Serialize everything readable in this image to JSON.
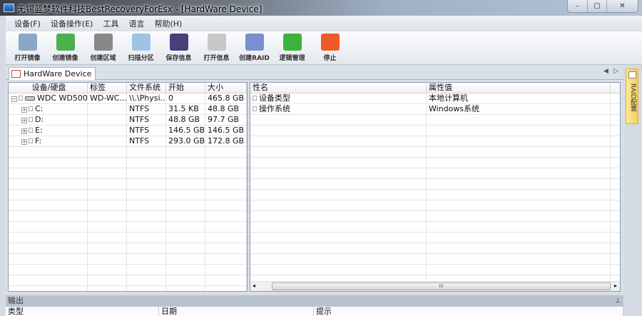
{
  "window": {
    "title": "无锡蓝梦软件科技BestRecoveryForEsx - [HardWare Device]",
    "min": "–",
    "max": "▢",
    "close": "✕"
  },
  "menu": [
    "设备(F)",
    "设备操作(E)",
    "工具",
    "语言",
    "帮助(H)"
  ],
  "toolbar": [
    {
      "label": "打开镜像",
      "icon": "open-image-icon",
      "color": "#8aa7c8"
    },
    {
      "label": "创建镜像",
      "icon": "create-image-icon",
      "color": "#4caf50"
    },
    {
      "label": "创建区域",
      "icon": "create-region-icon",
      "color": "#888888"
    },
    {
      "label": "扫描分区",
      "icon": "scan-partition-icon",
      "color": "#9fc3e6"
    },
    {
      "label": "保存信息",
      "icon": "save-info-icon",
      "color": "#4a3f78"
    },
    {
      "label": "打开信息",
      "icon": "open-info-icon",
      "color": "#c8c8c8"
    },
    {
      "label": "创建RAID",
      "icon": "create-raid-icon",
      "color": "#7a8fd0"
    },
    {
      "label": "逻辑管理",
      "icon": "logic-manage-icon",
      "color": "#3cb43c"
    },
    {
      "label": "停止",
      "icon": "stop-icon",
      "color": "#f05a28"
    }
  ],
  "tab": {
    "label": "HardWare Device"
  },
  "device_table": {
    "columns": [
      "设备/硬盘",
      "标签",
      "文件系统",
      "开始",
      "大小"
    ],
    "rows": [
      {
        "name": "WDC WD500...",
        "label": "WD-WC...",
        "fs": "\\\\.\\Physi...",
        "start": "0",
        "size": "465.8 GB"
      },
      {
        "name": "C:",
        "label": "",
        "fs": "NTFS",
        "start": "31.5 KB",
        "size": "48.8 GB"
      },
      {
        "name": "D:",
        "label": "",
        "fs": "NTFS",
        "start": "48.8 GB",
        "size": "97.7 GB"
      },
      {
        "name": "E:",
        "label": "",
        "fs": "NTFS",
        "start": "146.5 GB",
        "size": "146.5 GB"
      },
      {
        "name": "F:",
        "label": "",
        "fs": "NTFS",
        "start": "293.0 GB",
        "size": "172.8 GB"
      }
    ]
  },
  "prop_table": {
    "columns": [
      "性名",
      "属性值"
    ],
    "rows": [
      {
        "name": "设备类型",
        "value": "本地计算机"
      },
      {
        "name": "操作系统",
        "value": "Windows系统"
      }
    ],
    "scroll_thumb": "III"
  },
  "side_tab": "RAID配置",
  "output": {
    "title": "输出",
    "pin": "⊥",
    "columns": [
      "类型",
      "日期",
      "提示"
    ]
  }
}
